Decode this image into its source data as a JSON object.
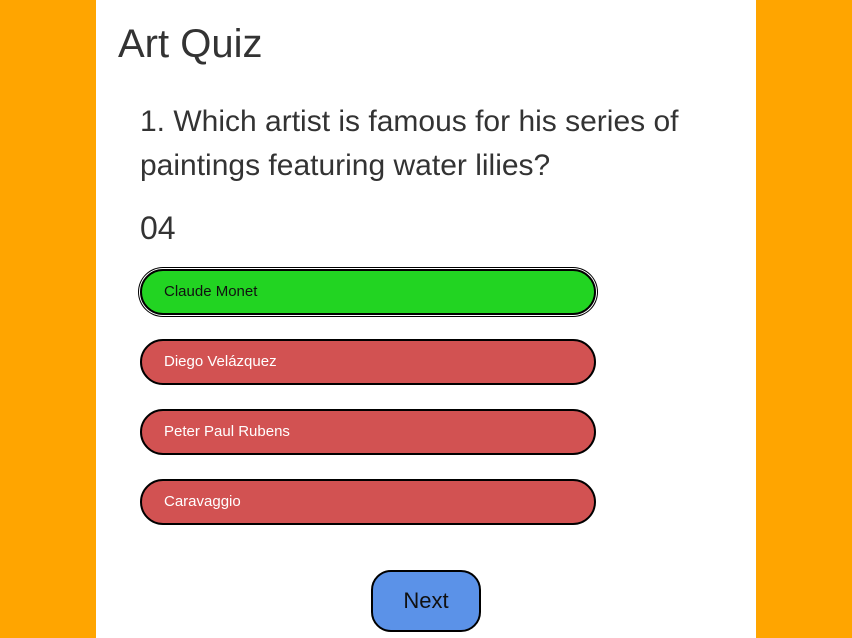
{
  "app": {
    "title": "Art Quiz"
  },
  "quiz": {
    "question": "1. Which artist is famous for his series of paintings featuring water lilies?",
    "timer": "04",
    "answers": [
      {
        "label": "Claude Monet",
        "state": "correct"
      },
      {
        "label": "Diego Velázquez",
        "state": "wrong"
      },
      {
        "label": "Peter Paul Rubens",
        "state": "wrong"
      },
      {
        "label": "Caravaggio",
        "state": "wrong"
      }
    ],
    "next_label": "Next"
  },
  "colors": {
    "background": "#ffa500",
    "correct": "#22d422",
    "wrong": "#d25252",
    "next_button": "#5b92e8"
  }
}
